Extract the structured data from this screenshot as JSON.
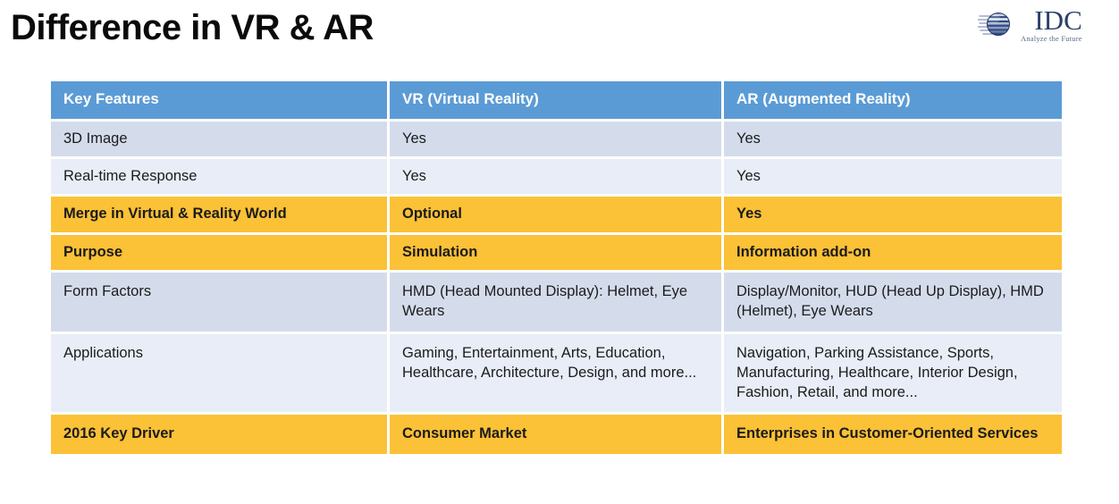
{
  "slide": {
    "title": "Difference in VR & AR",
    "logo": {
      "name": "IDC",
      "tagline": "Analyze the Future",
      "globe_icon": "idc-globe-icon"
    }
  },
  "colors": {
    "header_blue": "#5b9bd5",
    "band_a": "#d4dcec",
    "band_b": "#e8edf7",
    "highlight_orange": "#fbc137",
    "title_text": "#0b0b0b",
    "logo_navy": "#2b3f6b"
  },
  "table": {
    "headers": [
      "Key Features",
      "VR (Virtual Reality)",
      "AR (Augmented Reality)"
    ],
    "rows": [
      {
        "style": "band-a",
        "feature": "3D Image",
        "vr": "Yes",
        "ar": "Yes"
      },
      {
        "style": "band-b",
        "feature": "Real-time Response",
        "vr": "Yes",
        "ar": "Yes"
      },
      {
        "style": "highlight",
        "feature": "Merge in Virtual & Reality World",
        "vr": "Optional",
        "ar": "Yes"
      },
      {
        "style": "highlight",
        "feature": "Purpose",
        "vr": "Simulation",
        "ar": "Information add-on"
      },
      {
        "style": "band-a",
        "feature": "Form Factors",
        "vr": "HMD (Head Mounted Display): Helmet, Eye Wears",
        "ar": "Display/Monitor, HUD (Head Up Display), HMD (Helmet), Eye Wears"
      },
      {
        "style": "band-b",
        "feature": "Applications",
        "vr": "Gaming, Entertainment, Arts, Education, Healthcare, Architecture, Design, and more...",
        "ar": "Navigation, Parking Assistance, Sports, Manufacturing, Healthcare, Interior Design, Fashion, Retail, and more..."
      },
      {
        "style": "highlight",
        "feature": "2016 Key Driver",
        "vr": "Consumer Market",
        "ar": "Enterprises in Customer-Oriented Services"
      }
    ]
  }
}
